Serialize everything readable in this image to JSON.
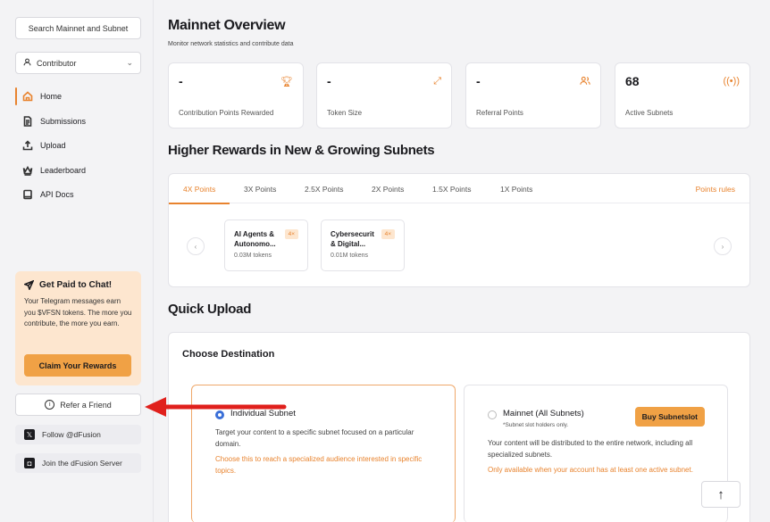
{
  "sidebar": {
    "search_label": "Search Mainnet and Subnet",
    "role_label": "Contributor",
    "nav": [
      {
        "label": "Home",
        "icon": "home-icon"
      },
      {
        "label": "Submissions",
        "icon": "document-icon"
      },
      {
        "label": "Upload",
        "icon": "upload-icon"
      },
      {
        "label": "Leaderboard",
        "icon": "crown-icon"
      },
      {
        "label": "API Docs",
        "icon": "book-icon"
      }
    ],
    "promo": {
      "title": "Get Paid to Chat!",
      "text": "Your Telegram messages earn you $VFSN tokens. The more you contribute, the more you earn.",
      "button": "Claim Your Rewards"
    },
    "refer_label": "Refer a Friend",
    "follow_label": "Follow @dFusion",
    "join_label": "Join the dFusion Server"
  },
  "main": {
    "title": "Mainnet Overview",
    "subtitle": "Monitor network statistics and contribute data",
    "stats": [
      {
        "value": "-",
        "label": "Contribution Points Rewarded",
        "icon": "trophy-icon"
      },
      {
        "value": "-",
        "label": "Token Size",
        "icon": "expand-icon"
      },
      {
        "value": "-",
        "label": "Referral Points",
        "icon": "users-icon"
      },
      {
        "value": "68",
        "label": "Active Subnets",
        "icon": "broadcast-icon"
      }
    ],
    "rewards_title": "Higher Rewards in New & Growing Subnets",
    "tabs": [
      "4X Points",
      "3X Points",
      "2.5X Points",
      "2X Points",
      "1.5X Points",
      "1X Points"
    ],
    "points_rules": "Points rules",
    "subnets": [
      {
        "name": "AI Agents & Autonomo...",
        "badge": "4×",
        "tokens": "0.03M tokens"
      },
      {
        "name": "Cybersecurit & Digital...",
        "badge": "4×",
        "tokens": "0.01M tokens"
      }
    ],
    "quick_upload_title": "Quick Upload",
    "destination_title": "Choose Destination",
    "options": [
      {
        "title": "Individual Subnet",
        "desc": "Target your content to a specific subnet focused on a particular domain.",
        "warn": "Choose this to reach a specialized audience interested in specific topics."
      },
      {
        "title": "Mainnet (All Subnets)",
        "note": "*Subnet slot holders only.",
        "desc": "Your content will be distributed to the entire network, including all specialized subnets.",
        "warn": "Only available when your account has at least one active subnet.",
        "button": "Buy Subnetslot"
      }
    ]
  },
  "colors": {
    "accent": "#e8832e",
    "annotation": "#e0201c"
  }
}
